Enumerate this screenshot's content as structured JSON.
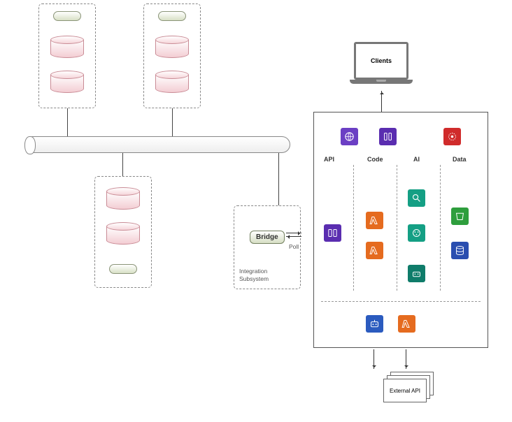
{
  "laptop": {
    "label": "Clients"
  },
  "bridge": {
    "label": "Bridge",
    "poll": "Poll"
  },
  "integration": {
    "line1": "Integration",
    "line2": "Subsystem"
  },
  "columns": {
    "api": "API",
    "code": "Code",
    "ai": "AI",
    "data": "Data"
  },
  "external": {
    "label": "External API"
  },
  "icons": {
    "top1": "globe-icon",
    "top2": "api-gateway-icon",
    "top3": "bug-icon",
    "api1": "api-icon",
    "code1": "lambda-icon",
    "code2": "lambda-icon",
    "ai1": "search-icon",
    "ai2": "brain-icon",
    "ai3": "ml-icon",
    "data1": "bucket-icon",
    "data2": "dbstack-icon",
    "bot1": "robot-icon",
    "bot2": "lambda-icon"
  }
}
